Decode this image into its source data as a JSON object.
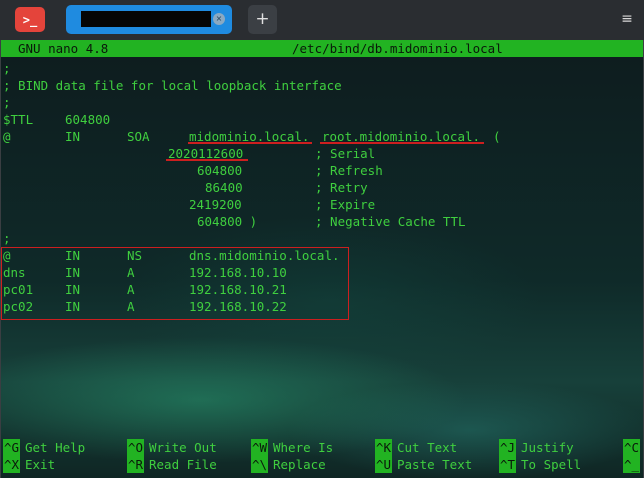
{
  "terminal": {
    "app_icon": ">_",
    "tab_title": "redacted",
    "tab_close_glyph": "×",
    "new_tab_glyph": "+",
    "menu_glyph": "≡",
    "accent_tab": "#1f8be0",
    "app_icon_color": "#e4443b"
  },
  "nano": {
    "version": "GNU nano 4.8",
    "filename": "/etc/bind/db.midominio.local",
    "bar_color": "#22b322",
    "text_color": "#3fcf3f",
    "annotation_color": "#cc1f1f"
  },
  "file": {
    "l1": ";",
    "l2": "; BIND data file for local loopback interface",
    "l3": ";",
    "ttl_key": "$TTL",
    "ttl_val": "604800",
    "soa": {
      "name": "@",
      "class": "IN",
      "type": "SOA",
      "primary": "midominio.local.",
      "admin": "root.midominio.local.",
      "paren": "("
    },
    "serial": {
      "value": "2020112600",
      "comment": "; Serial"
    },
    "refresh": {
      "value": "604800",
      "comment": "; Refresh"
    },
    "retry": {
      "value": "86400",
      "comment": "; Retry"
    },
    "expire": {
      "value": "2419200",
      "comment": "; Expire"
    },
    "neg": {
      "value": "604800 )",
      "comment": "; Negative Cache TTL"
    },
    "l10": ";",
    "records": [
      {
        "name": "@",
        "class": "IN",
        "type": "NS",
        "data": "dns.midominio.local."
      },
      {
        "name": "dns",
        "class": "IN",
        "type": "A",
        "data": "192.168.10.10"
      },
      {
        "name": "pc01",
        "class": "IN",
        "type": "A",
        "data": "192.168.10.21"
      },
      {
        "name": "pc02",
        "class": "IN",
        "type": "A",
        "data": "192.168.10.22"
      }
    ]
  },
  "shortcuts": [
    {
      "key": "^G",
      "label": "Get Help"
    },
    {
      "key": "^O",
      "label": "Write Out"
    },
    {
      "key": "^W",
      "label": "Where Is"
    },
    {
      "key": "^K",
      "label": "Cut Text"
    },
    {
      "key": "^J",
      "label": "Justify"
    },
    {
      "key": "^C",
      "label": ""
    },
    {
      "key": "^X",
      "label": "Exit"
    },
    {
      "key": "^R",
      "label": "Read File"
    },
    {
      "key": "^\\",
      "label": "Replace"
    },
    {
      "key": "^U",
      "label": "Paste Text"
    },
    {
      "key": "^T",
      "label": "To Spell"
    },
    {
      "key": "^_",
      "label": ""
    }
  ]
}
